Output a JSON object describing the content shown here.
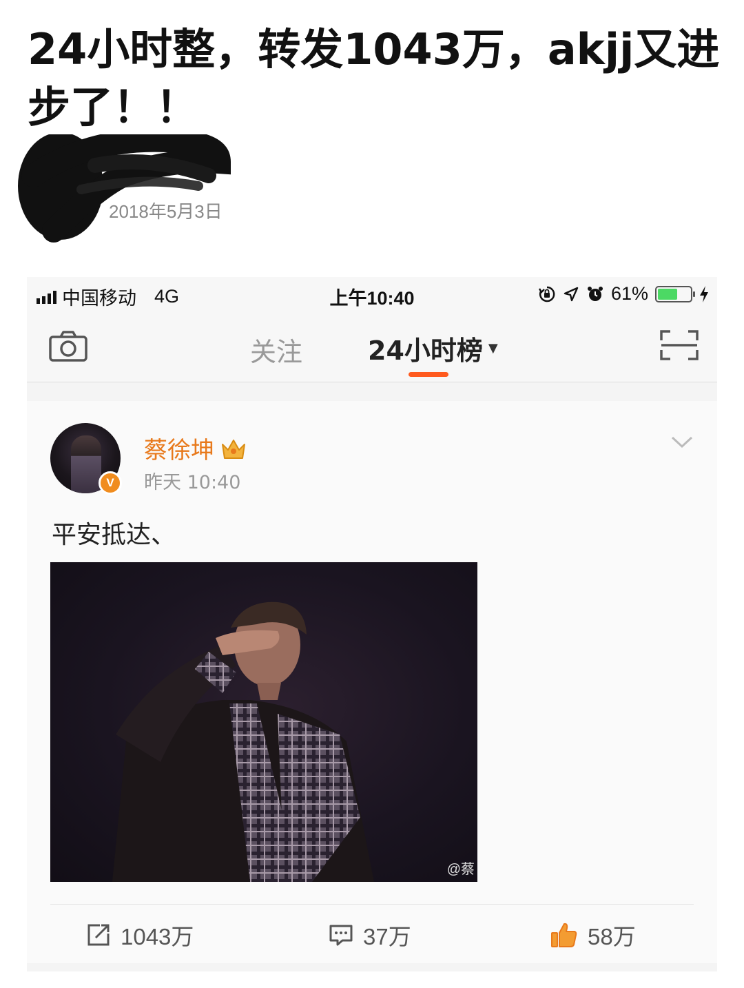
{
  "headline": "24小时整，转发1043万，akjj又进步了！！",
  "article": {
    "date": "2018年5月3日"
  },
  "statusbar": {
    "carrier": "中国移动",
    "network": "4G",
    "time": "上午10:40",
    "battery_percent": "61%",
    "battery_level": 0.61
  },
  "nav": {
    "tab_follow": "关注",
    "tab_hot": "24小时榜",
    "camera_icon": "camera-icon",
    "scan_icon": "scan-icon"
  },
  "post": {
    "username": "蔡徐坤",
    "time": "昨天 10:40",
    "text": "平安抵达、",
    "verified_badge": "V",
    "image_watermark": "@蔡",
    "repost_count": "1043万",
    "comment_count": "37万",
    "like_count": "58万"
  },
  "colors": {
    "accent": "#ff5a1e",
    "username": "#e8791b",
    "battery": "#4cd964"
  }
}
